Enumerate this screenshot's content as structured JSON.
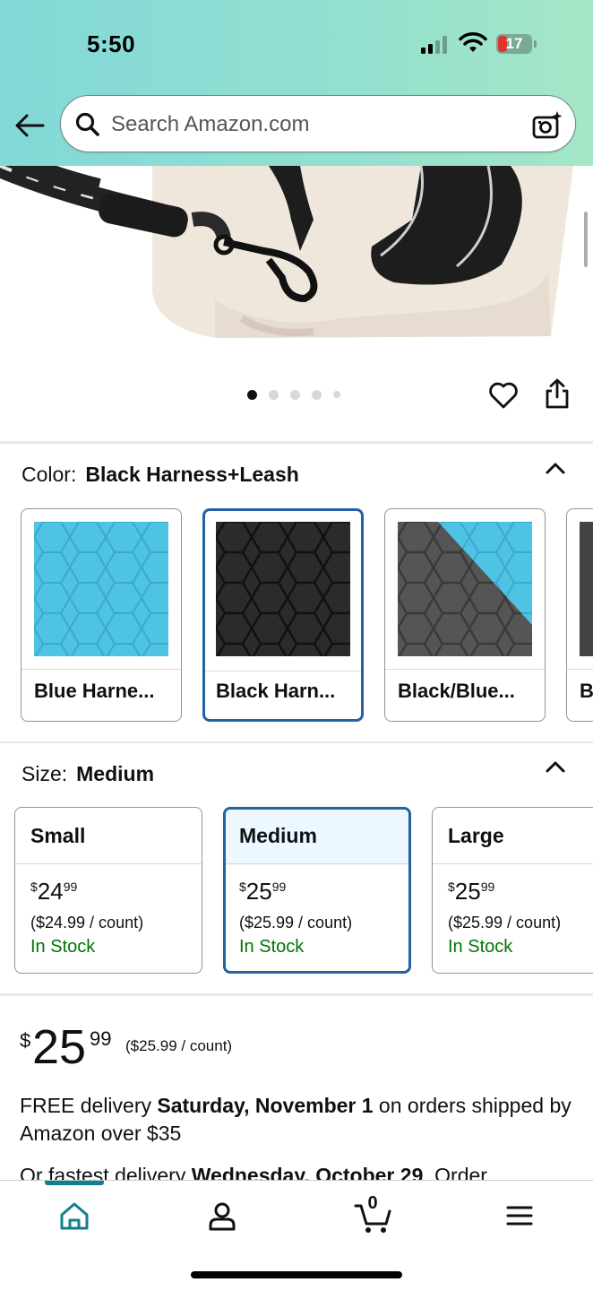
{
  "status_bar": {
    "time": "5:50",
    "battery": "17"
  },
  "search": {
    "placeholder": "Search Amazon.com"
  },
  "carousel": {
    "page_count": 5,
    "active_index": 0
  },
  "color": {
    "label": "Color:",
    "selected": "Black Harness+Leash",
    "options": [
      {
        "label": "Blue Harne...",
        "selected": false
      },
      {
        "label": "Black Harn...",
        "selected": true
      },
      {
        "label": "Black/Blue...",
        "selected": false
      },
      {
        "label": "B",
        "selected": false
      }
    ]
  },
  "size": {
    "label": "Size:",
    "selected": "Medium",
    "options": [
      {
        "name": "Small",
        "price_whole": "24",
        "price_fraction": "99",
        "currency": "$",
        "unit_price": "($24.99 / count)",
        "stock": "In Stock"
      },
      {
        "name": "Medium",
        "price_whole": "25",
        "price_fraction": "99",
        "currency": "$",
        "unit_price": "($25.99 / count)",
        "stock": "In Stock"
      },
      {
        "name": "Large",
        "price_whole": "25",
        "price_fraction": "99",
        "currency": "$",
        "unit_price": "($25.99 / count)",
        "stock": "In Stock"
      }
    ]
  },
  "price": {
    "currency": "$",
    "whole": "25",
    "fraction": "99",
    "unit_price": "($25.99 / count)"
  },
  "delivery": {
    "prefix": "FREE delivery ",
    "date": "Saturday, November 1",
    "suffix": " on orders shipped by Amazon over $35"
  },
  "fastest": {
    "prefix": "Or fastest delivery ",
    "date": "Wednesday, October 29",
    "suffix": ". Order"
  },
  "bottom_nav": {
    "cart_count": "0"
  },
  "colors": {
    "header_gradient_start": "#82d8d8",
    "header_gradient_end": "#a5e6c6",
    "selected_border": "#2162a1",
    "in_stock": "#007600",
    "nav_accent": "#117f90",
    "blue_fabric": "#4fc3e4",
    "black_fabric": "#2b2b2b"
  }
}
